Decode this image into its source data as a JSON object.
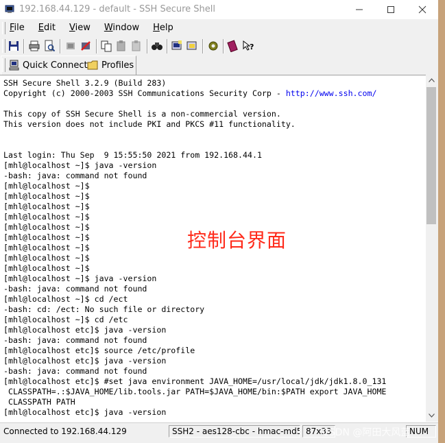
{
  "window": {
    "title": "192.168.44.129 - default - SSH Secure Shell"
  },
  "menubar": {
    "items": [
      {
        "key": "F",
        "rest": "ile"
      },
      {
        "key": "E",
        "rest": "dit"
      },
      {
        "key": "V",
        "rest": "iew"
      },
      {
        "key": "W",
        "rest": "indow"
      },
      {
        "key": "H",
        "rest": "elp"
      }
    ]
  },
  "toolbar2": {
    "quick_connect": "Quick Connect",
    "profiles": "Profiles"
  },
  "terminal": {
    "lines": [
      "SSH Secure Shell 3.2.9 (Build 283)",
      "Copyright (c) 2000-2003 SSH Communications Security Corp - ",
      "",
      "This copy of SSH Secure Shell is a non-commercial version.",
      "This version does not include PKI and PKCS #11 functionality.",
      "",
      "",
      "Last login: Thu Sep  9 15:55:50 2021 from 192.168.44.1",
      "[mhl@localhost ~]$ java -version",
      "-bash: java: command not found",
      "[mhl@localhost ~]$",
      "[mhl@localhost ~]$",
      "[mhl@localhost ~]$",
      "[mhl@localhost ~]$",
      "[mhl@localhost ~]$",
      "[mhl@localhost ~]$",
      "[mhl@localhost ~]$",
      "[mhl@localhost ~]$",
      "[mhl@localhost ~]$",
      "[mhl@localhost ~]$ java -version",
      "-bash: java: command not found",
      "[mhl@localhost ~]$ cd /ect",
      "-bash: cd: /ect: No such file or directory",
      "[mhl@localhost ~]$ cd /etc",
      "[mhl@localhost etc]$ java -version",
      "-bash: java: command not found",
      "[mhl@localhost etc]$ source /etc/profile",
      "[mhl@localhost etc]$ java -version",
      "-bash: java: command not found",
      "[mhl@localhost etc]$ #set java environment JAVA_HOME=/usr/local/jdk/jdk1.8.0_131",
      " CLASSPATH=.:$JAVA_HOME/lib.tools.jar PATH=$JAVA_HOME/bin:$PATH export JAVA_HOME",
      " CLASSPATH PATH",
      "[mhl@localhost etc]$ java -version"
    ],
    "link": "http://www.ssh.com/",
    "overlay_label": "控制台界面"
  },
  "statusbar": {
    "connection": "Connected to 192.168.44.129",
    "cipher": "SSH2 - aes128-cbc - hmac-md5",
    "size": "87x33",
    "extra": "NUM"
  },
  "watermark": "CSDN @阿田大风蓝",
  "colors": {
    "overlay": "#ff2a1a",
    "link": "#0000ee"
  }
}
